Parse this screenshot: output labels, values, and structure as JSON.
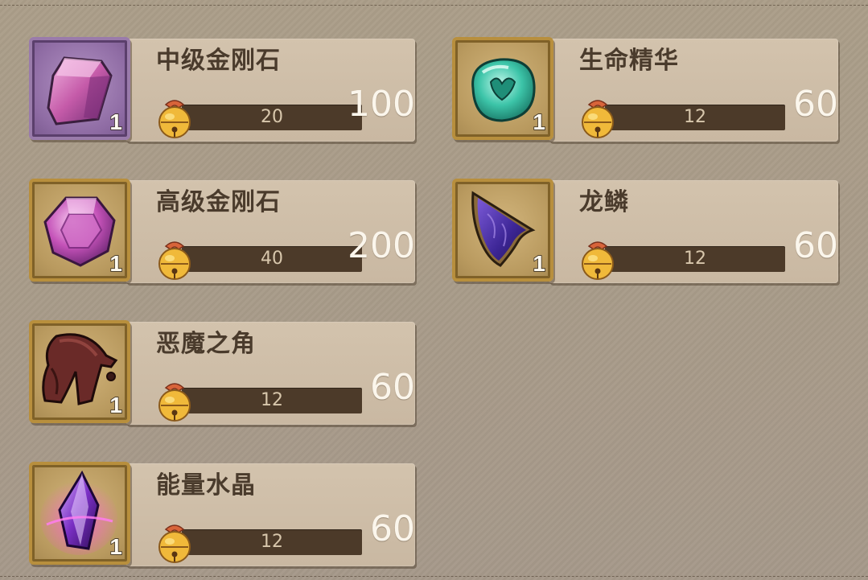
{
  "items": [
    {
      "name": "中级金刚石",
      "quantity": "1",
      "cost": "20",
      "price": "100",
      "icon": "pink-diamond-icon",
      "frame": "purple"
    },
    {
      "name": "生命精华",
      "quantity": "1",
      "cost": "12",
      "price": "60",
      "icon": "teal-essence-icon",
      "frame": "gold"
    },
    {
      "name": "高级金刚石",
      "quantity": "1",
      "cost": "40",
      "price": "200",
      "icon": "pink-gem-icon",
      "frame": "gold"
    },
    {
      "name": "龙鳞",
      "quantity": "1",
      "cost": "12",
      "price": "60",
      "icon": "dragon-scale-icon",
      "frame": "gold"
    },
    {
      "name": "恶魔之角",
      "quantity": "1",
      "cost": "12",
      "price": "60",
      "icon": "demon-horn-icon",
      "frame": "gold"
    },
    {
      "name": "能量水晶",
      "quantity": "1",
      "cost": "12",
      "price": "60",
      "icon": "energy-crystal-icon",
      "frame": "gold"
    }
  ],
  "colors": {
    "price_text": "#fbf6ec",
    "bar_bg": "#4c3a29",
    "name_text": "#4a3b2c",
    "gold_frame": "#b88f3d",
    "purple_frame": "#9a7bab"
  },
  "currency_icon": "bell-icon"
}
